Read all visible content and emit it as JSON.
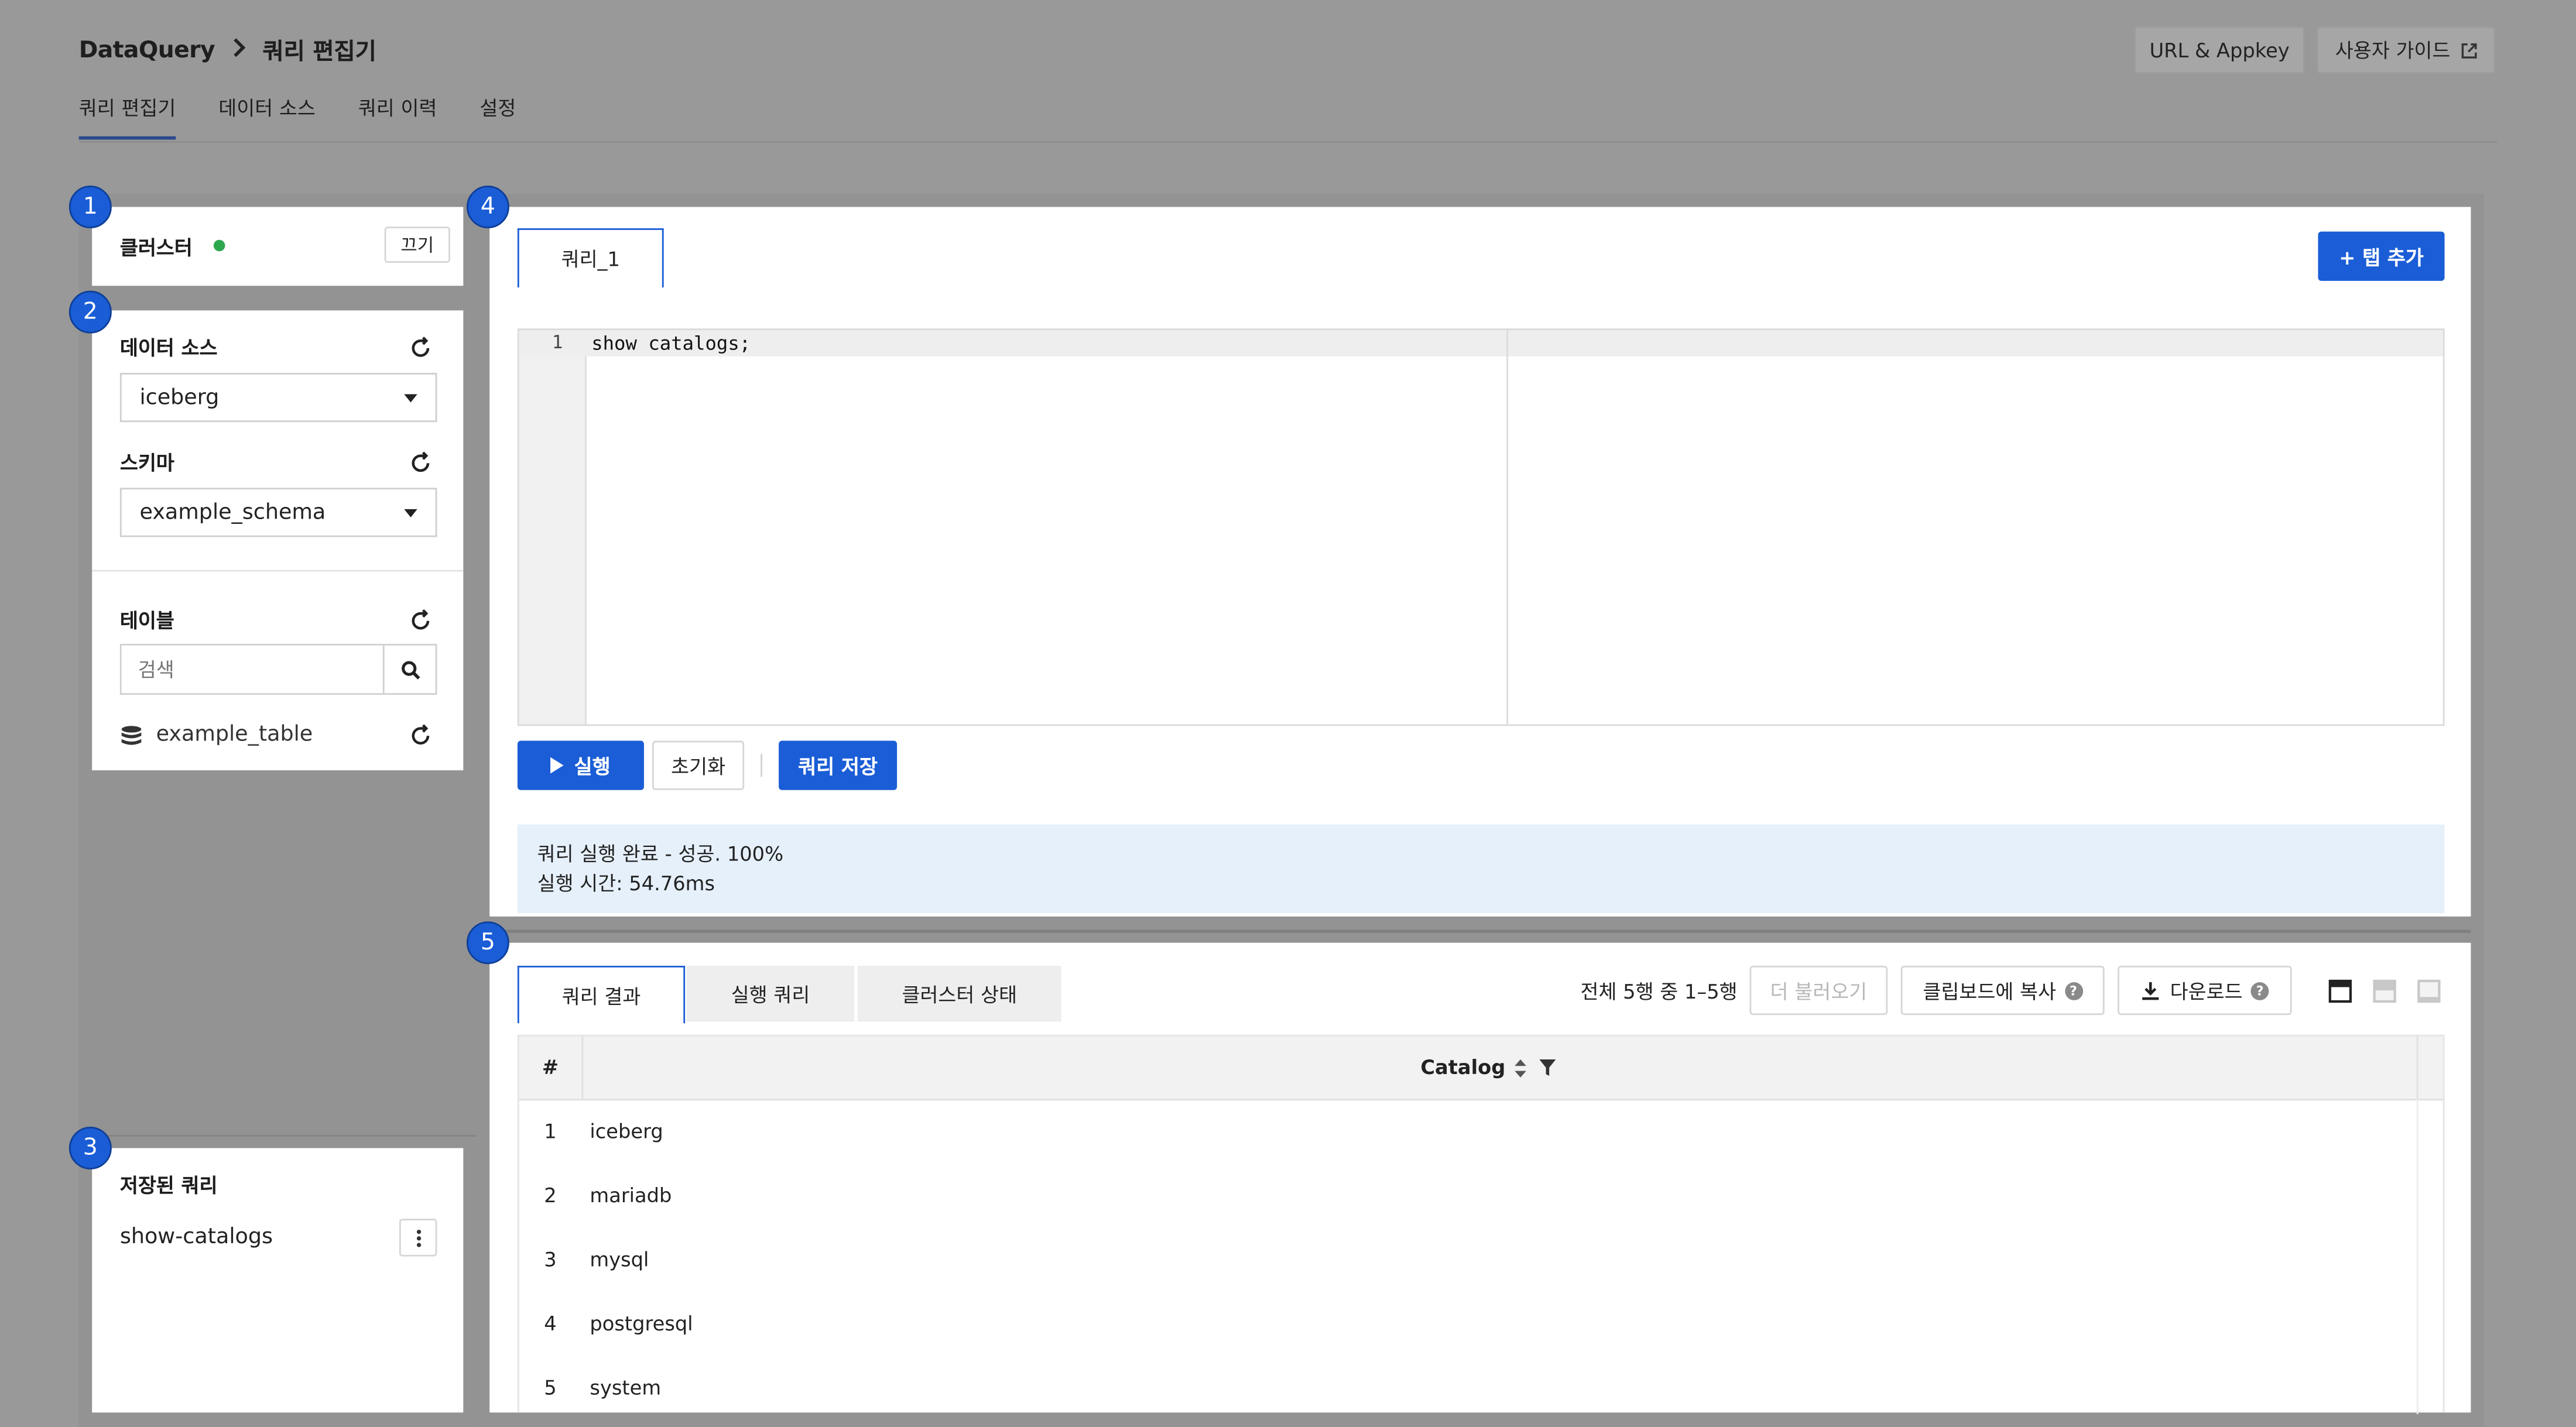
{
  "breadcrumb": {
    "root": "DataQuery",
    "separator": ">",
    "current": "쿼리 편집기"
  },
  "header_buttons": {
    "url_appkey": "URL & Appkey",
    "user_guide": "사용자 가이드"
  },
  "nav_tabs": [
    "쿼리 편집기",
    "데이터 소스",
    "쿼리 이력",
    "설정"
  ],
  "badges": [
    "1",
    "2",
    "3",
    "4",
    "5"
  ],
  "cluster": {
    "label": "클러스터",
    "status_color": "#2ea84f",
    "off_button": "끄기"
  },
  "datasource": {
    "label": "데이터 소스",
    "value": "iceberg",
    "schema_label": "스키마",
    "schema_value": "example_schema"
  },
  "tables": {
    "label": "테이블",
    "search_placeholder": "검색",
    "items": [
      "example_table"
    ]
  },
  "saved_queries": {
    "label": "저장된 쿼리",
    "items": [
      "show-catalogs"
    ]
  },
  "editor": {
    "tab": "쿼리_1",
    "add_tab": "+ 탭 추가",
    "line_number": "1",
    "code": "show catalogs;"
  },
  "actions": {
    "run": "실행",
    "reset": "초기화",
    "save": "쿼리 저장"
  },
  "status": {
    "line1": "쿼리 실행 완료 - 성공. 100%",
    "line2": "실행 시간: 54.76ms"
  },
  "result": {
    "tabs": [
      "쿼리 결과",
      "실행 쿼리",
      "클러스터 상태"
    ],
    "summary": "전체 5행 중 1–5행",
    "load_more": "더 불러오기",
    "copy": "클립보드에 복사",
    "download": "다운로드",
    "columns": [
      "#",
      "Catalog"
    ],
    "rows": [
      [
        "1",
        "iceberg"
      ],
      [
        "2",
        "mariadb"
      ],
      [
        "3",
        "mysql"
      ],
      [
        "4",
        "postgresql"
      ],
      [
        "5",
        "system"
      ]
    ]
  },
  "colors": {
    "accent": "#1a5dd6",
    "overlay": "#999999",
    "status_bg": "#e6f0fb"
  }
}
